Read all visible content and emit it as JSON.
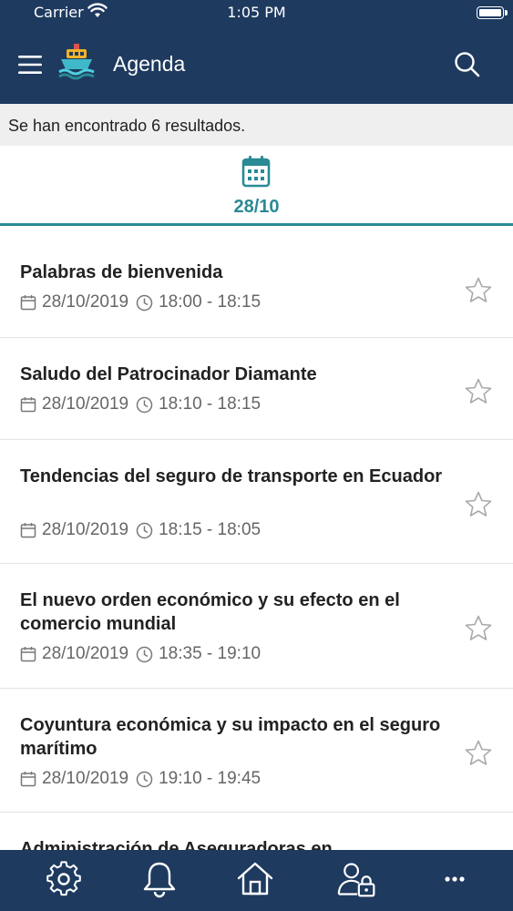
{
  "status_bar": {
    "carrier": "Carrier",
    "time": "1:05 PM"
  },
  "nav": {
    "title": "Agenda",
    "menu_icon": "menu-icon",
    "logo_icon": "ship-logo-icon",
    "search_icon": "search-icon"
  },
  "results": {
    "text": "Se han encontrado 6 resultados."
  },
  "date_tab": {
    "label": "28/10",
    "icon": "calendar-icon",
    "accent": "#2a8a95"
  },
  "items": [
    {
      "title": "Palabras de bienvenida",
      "date": "28/10/2019",
      "time": "18:00 - 18:15"
    },
    {
      "title": "Saludo del Patrocinador Diamante",
      "date": "28/10/2019",
      "time": "18:10 - 18:15"
    },
    {
      "title": "Tendencias del seguro de transporte en Ecuador",
      "date": "28/10/2019",
      "time": "18:15 - 18:05"
    },
    {
      "title": "El nuevo orden económico y su efecto en el comercio mundial",
      "date": "28/10/2019",
      "time": "18:35 - 19:10"
    },
    {
      "title": "Coyuntura económica y su impacto en el seguro marítimo",
      "date": "28/10/2019",
      "time": "19:10 - 19:45"
    },
    {
      "title": "Administración de Aseguradoras en",
      "date": "",
      "time": ""
    }
  ],
  "tabbar": {
    "icons": [
      "gear-icon",
      "bell-icon",
      "home-icon",
      "user-lock-icon",
      "more-icon"
    ]
  },
  "colors": {
    "header": "#1e3a5f",
    "accent": "#2a8a95"
  }
}
